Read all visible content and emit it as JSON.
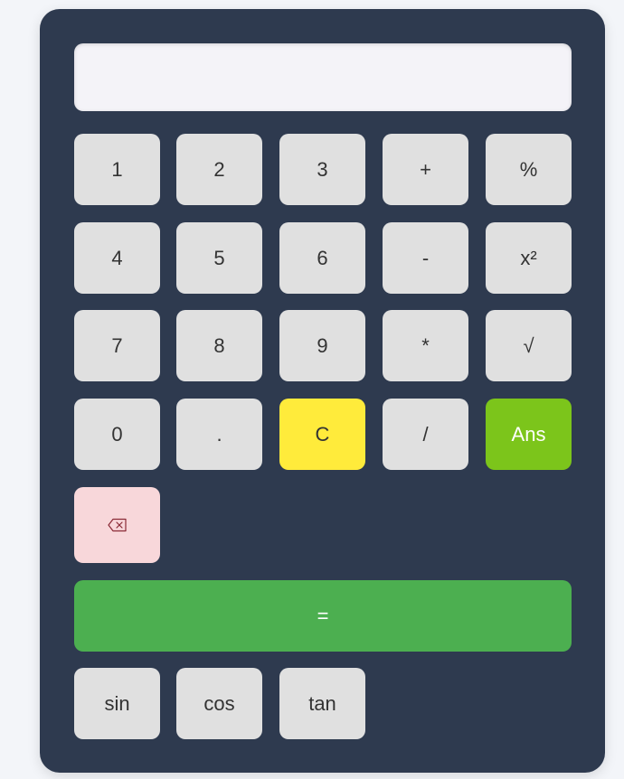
{
  "display": {
    "value": "",
    "placeholder": ""
  },
  "keypad": {
    "row1": [
      "1",
      "2",
      "3",
      "+",
      "%"
    ],
    "row2": [
      "4",
      "5",
      "6",
      "-",
      "x²"
    ],
    "row3": [
      "7",
      "8",
      "9",
      "*",
      "√"
    ],
    "row4": [
      "0",
      ".",
      "C",
      "/",
      "Ans"
    ],
    "backspace_icon": "backspace-icon",
    "equals": "=",
    "trig": [
      "sin",
      "cos",
      "tan"
    ]
  },
  "colors": {
    "body_bg": "#2e3a4f",
    "key_bg": "#e0e0e0",
    "clear_bg": "#ffeb3b",
    "ans_bg": "#7cc51b",
    "backspace_bg": "#f8d7da",
    "equals_bg": "#4caf50"
  }
}
